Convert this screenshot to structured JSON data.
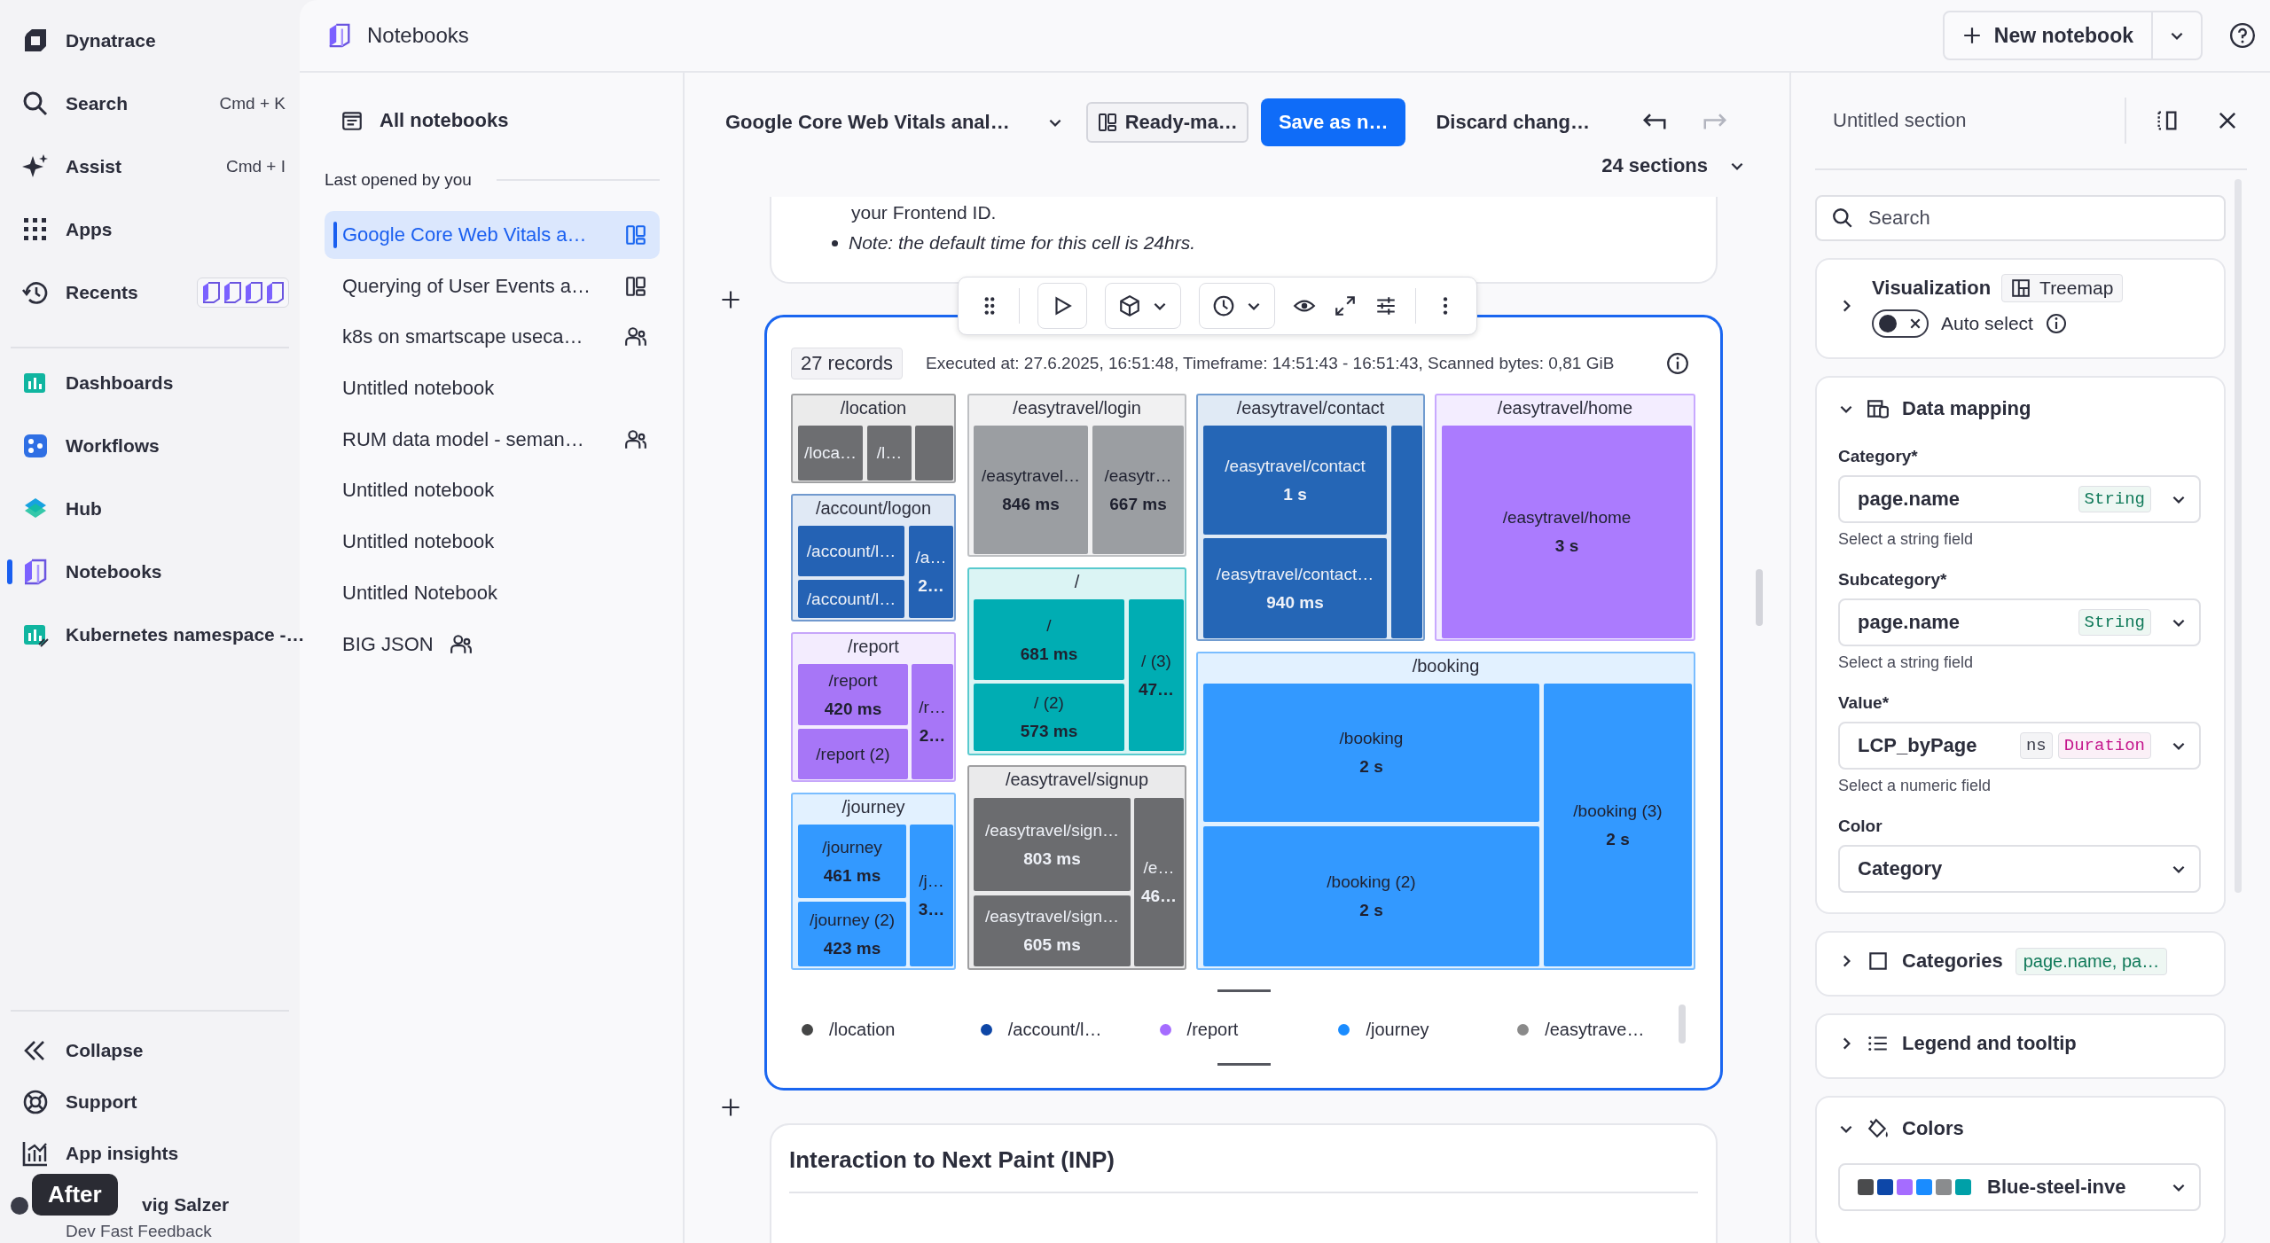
{
  "nav": {
    "brand": "Dynatrace",
    "tools": [
      {
        "label": "Search",
        "shortcut": "Cmd + K",
        "kind": "search"
      },
      {
        "label": "Assist",
        "shortcut": "Cmd + I",
        "kind": "assist"
      },
      {
        "label": "Apps",
        "kind": "apps"
      },
      {
        "label": "Recents",
        "kind": "recents"
      }
    ],
    "apps": [
      {
        "label": "Dashboards",
        "selected": false,
        "kind": "dashboards"
      },
      {
        "label": "Workflows",
        "selected": false,
        "kind": "workflows"
      },
      {
        "label": "Hub",
        "selected": false,
        "kind": "hub"
      },
      {
        "label": "Notebooks",
        "selected": true,
        "kind": "notebooks"
      },
      {
        "label": "Kubernetes namespace -…",
        "selected": false,
        "kind": "dashboard-link"
      }
    ],
    "bottom": [
      {
        "label": "Collapse",
        "kind": "collapse"
      },
      {
        "label": "Support",
        "kind": "support"
      },
      {
        "label": "App insights",
        "kind": "insights"
      }
    ],
    "user": {
      "name": "vig Salzer",
      "subtitle": "Dev Fast Feedback"
    },
    "overlay_badge": "After"
  },
  "header": {
    "title": "Notebooks",
    "new_button": "New notebook"
  },
  "notebook_list": {
    "all": "All notebooks",
    "section_label": "Last opened by you",
    "items": [
      {
        "title": "Google Core Web Vitals a…",
        "selected": true,
        "kind": "ready-made"
      },
      {
        "title": "Querying of User Events a…",
        "selected": false,
        "kind": "ready-made"
      },
      {
        "title": "k8s on smartscape useca…",
        "selected": false,
        "kind": "shared"
      },
      {
        "title": "Untitled notebook",
        "selected": false,
        "kind": "plain"
      },
      {
        "title": "RUM data model - seman…",
        "selected": false,
        "kind": "shared"
      },
      {
        "title": "Untitled notebook",
        "selected": false,
        "kind": "plain"
      },
      {
        "title": "Untitled notebook",
        "selected": false,
        "kind": "plain"
      },
      {
        "title": "Untitled Notebook",
        "selected": false,
        "kind": "plain"
      },
      {
        "title": "BIG JSON",
        "selected": false,
        "kind": "shared"
      }
    ]
  },
  "toolbar": {
    "notebook_title": "Google Core Web Vitals anal…",
    "ready_made": "Ready-ma…",
    "save": "Save as n…",
    "discard": "Discard chang…",
    "undo_disabled": false,
    "redo_disabled": true,
    "sections": "24 sections"
  },
  "previous_section": {
    "line": "your Frontend ID.",
    "note": "Note: the default time for this cell is 24hrs."
  },
  "cell": {
    "selected": true,
    "records": "27 records",
    "executed": "Executed at: 27.6.2025, 16:51:48, Timeframe: 14:51:43 - 16:51:43, Scanned bytes: 0,81 GiB",
    "treemap": {
      "groups": [
        {
          "name": "/location",
          "color": "#6d6e71",
          "tiles": [
            {
              "kind": "label",
              "label": "/loca…"
            },
            {
              "kind": "label",
              "label": "/l…"
            },
            {
              "kind": "blank"
            }
          ]
        },
        {
          "name": "/account/logon",
          "color": "#2462b4",
          "tiles": [
            {
              "kind": "label",
              "label": "/account/l…"
            },
            {
              "kind": "label",
              "label": "/account/l…"
            },
            {
              "kind": "label",
              "label": "/a…",
              "value": "2…"
            }
          ]
        },
        {
          "name": "/report",
          "color": "#a776f7",
          "tiles": [
            {
              "kind": "label",
              "label": "/report",
              "value": "420 ms"
            },
            {
              "kind": "label",
              "label": "/report (2)"
            },
            {
              "kind": "label",
              "label": "/r…",
              "value": "2…"
            }
          ]
        },
        {
          "name": "/journey",
          "color": "#3399ff",
          "tiles": [
            {
              "kind": "label",
              "label": "/journey",
              "value": "461 ms"
            },
            {
              "kind": "label",
              "label": "/journey (2)",
              "value": "423 ms"
            },
            {
              "kind": "label",
              "label": "/j…",
              "value": "3…"
            }
          ]
        },
        {
          "name": "/easytravel/login",
          "color": "#9b9ea2",
          "tiles": [
            {
              "kind": "label",
              "label": "/easytravel…",
              "value": "846 ms"
            },
            {
              "kind": "label",
              "label": "/easytr…",
              "value": "667 ms"
            }
          ]
        },
        {
          "name": "/",
          "color": "#00adb3",
          "tiles": [
            {
              "kind": "label",
              "label": "/",
              "value": "681 ms"
            },
            {
              "kind": "label",
              "label": "/ (2)",
              "value": "573 ms"
            },
            {
              "kind": "label",
              "label": "/ (3)",
              "value": "47…"
            }
          ]
        },
        {
          "name": "/easytravel/signup",
          "color": "#6b6c6f",
          "tiles": [
            {
              "kind": "label",
              "label": "/easytravel/sign…",
              "value": "803 ms"
            },
            {
              "kind": "label",
              "label": "/easytravel/sign…",
              "value": "605 ms"
            },
            {
              "kind": "label",
              "label": "/e…",
              "value": "46…"
            }
          ]
        },
        {
          "name": "/easytravel/contact",
          "color": "#2566b6",
          "tiles": [
            {
              "kind": "label",
              "label": "/easytravel/contact",
              "value": "1 s"
            },
            {
              "kind": "label",
              "label": "/easytravel/contact…",
              "value": "940 ms"
            },
            {
              "kind": "blank"
            }
          ]
        },
        {
          "name": "/easytravel/home",
          "color": "#ab7bfe",
          "tiles": [
            {
              "kind": "label",
              "label": "/easytravel/home",
              "value": "3 s"
            }
          ]
        },
        {
          "name": "/booking",
          "color": "#3399ff",
          "tiles": [
            {
              "kind": "label",
              "label": "/booking",
              "value": "2 s"
            },
            {
              "kind": "label",
              "label": "/booking (2)",
              "value": "2 s"
            },
            {
              "kind": "label",
              "label": "/booking (3)",
              "value": "2 s"
            }
          ]
        }
      ]
    },
    "legend": [
      {
        "label": "/location",
        "color": "#454646"
      },
      {
        "label": "/account/l…",
        "color": "#0e46a6"
      },
      {
        "label": "/report",
        "color": "#a56cff"
      },
      {
        "label": "/journey",
        "color": "#1a8cff"
      },
      {
        "label": "/easytrave…",
        "color": "#8a8a8a"
      }
    ]
  },
  "next_section": {
    "title": "Interaction to Next Paint (INP)"
  },
  "panel": {
    "title": "Untitled section",
    "search_placeholder": "Search",
    "visualization": {
      "label": "Visualization",
      "type": "Treemap",
      "expanded": false,
      "auto_select": {
        "label": "Auto select",
        "on": false
      }
    },
    "data_mapping": {
      "label": "Data mapping",
      "expanded": true,
      "fields": [
        {
          "label": "Category*",
          "value": "page.name",
          "tags": [
            {
              "text": "String",
              "kind": "string"
            }
          ],
          "hint": "Select a string field"
        },
        {
          "label": "Subcategory*",
          "value": "page.name",
          "tags": [
            {
              "text": "String",
              "kind": "string"
            }
          ],
          "hint": "Select a string field"
        },
        {
          "label": "Value*",
          "value": "LCP_byPage",
          "tags": [
            {
              "text": "ns",
              "kind": "unit"
            },
            {
              "text": "Duration",
              "kind": "duration"
            }
          ],
          "hint": "Select a numeric field"
        },
        {
          "label": "Color",
          "value": "Category"
        }
      ]
    },
    "categories": {
      "label": "Categories",
      "tag": "page.name, pa…",
      "expanded": false
    },
    "legend": {
      "label": "Legend and tooltip",
      "expanded": false
    },
    "colors": {
      "label": "Colors",
      "expanded": true,
      "palette": "Blue-steel-inve",
      "swatches": [
        {
          "color": "#4a4b4d"
        },
        {
          "color": "#0d47a8"
        },
        {
          "color": "#a56cff"
        },
        {
          "color": "#1a8cff"
        },
        {
          "color": "#8a8c8e"
        },
        {
          "color": "#00a0a8"
        }
      ]
    }
  }
}
